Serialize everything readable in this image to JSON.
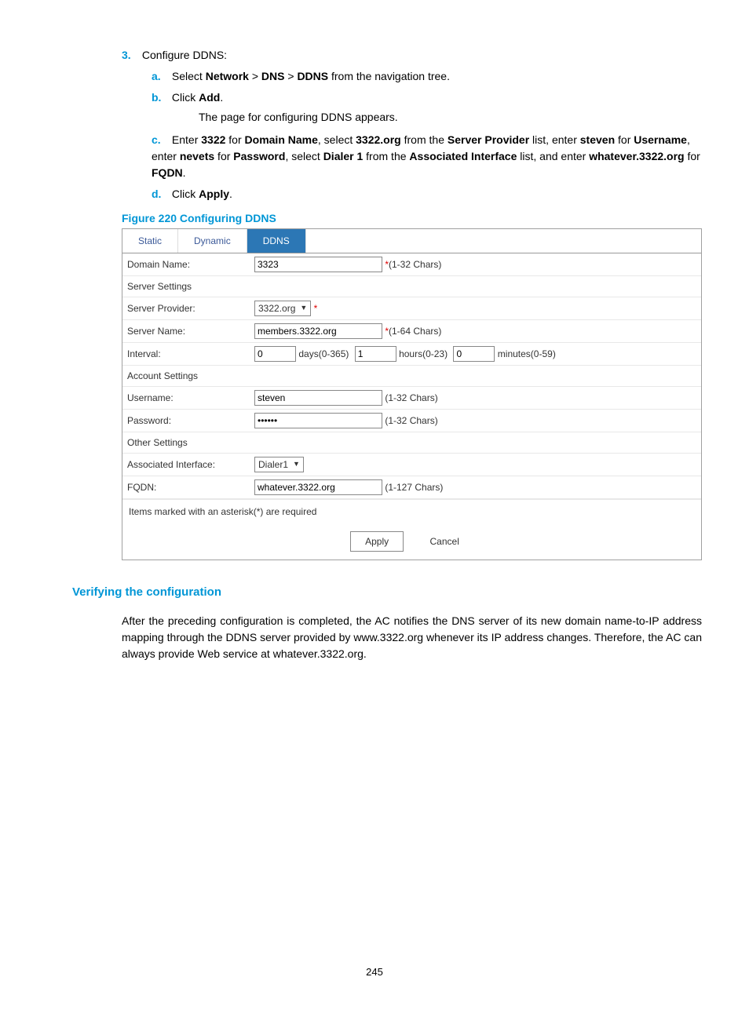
{
  "step": {
    "num": "3.",
    "title": "Configure DDNS:",
    "a": {
      "let": "a.",
      "pre": "Select ",
      "b1": "Network",
      "gt1": " > ",
      "b2": "DNS",
      "gt2": " > ",
      "b3": "DDNS",
      "post": " from the navigation tree."
    },
    "b": {
      "let": "b.",
      "pre": "Click ",
      "b1": "Add",
      "post": ".",
      "note": "The page for configuring DDNS appears."
    },
    "c": {
      "let": "c.",
      "t1": "Enter ",
      "b1": "3322",
      "t2": " for ",
      "b2": "Domain Name",
      "t3": ", select ",
      "b3": "3322.org",
      "t4": " from the ",
      "b4": "Server Provider",
      "t5": " list, enter ",
      "b5": "steven",
      "t6": " for ",
      "b6": "Username",
      "t7": ", enter ",
      "b7": "nevets",
      "t8": " for ",
      "b8": "Password",
      "t9": ", select ",
      "b9": "Dialer 1",
      "t10": " from the ",
      "b10": "Associated Interface",
      "t11": " list, and enter ",
      "b11": "whatever.3322.org",
      "t12": " for ",
      "b12": "FQDN",
      "t13": "."
    },
    "d": {
      "let": "d.",
      "pre": "Click ",
      "b1": "Apply",
      "post": "."
    }
  },
  "figure_caption": "Figure 220 Configuring DDNS",
  "shot": {
    "tabs": {
      "static": "Static",
      "dynamic": "Dynamic",
      "ddns": "DDNS"
    },
    "domain_label": "Domain Name:",
    "domain_value": "3323",
    "domain_hint": "*(1-32 Chars)",
    "server_settings": "Server Settings",
    "provider_label": "Server Provider:",
    "provider_value": "3322.org",
    "provider_star": "*",
    "servername_label": "Server Name:",
    "servername_value": "members.3322.org",
    "servername_hint": "*(1-64 Chars)",
    "interval_label": "Interval:",
    "days_value": "0",
    "days_label": "days(0-365)",
    "hours_value": "1",
    "hours_label": "hours(0-23)",
    "minutes_value": "0",
    "minutes_label": "minutes(0-59)",
    "account_settings": "Account Settings",
    "username_label": "Username:",
    "username_value": "steven",
    "username_hint": "(1-32 Chars)",
    "password_label": "Password:",
    "password_value": "••••••",
    "password_hint": "(1-32 Chars)",
    "other_settings": "Other Settings",
    "assoc_label": "Associated Interface:",
    "assoc_value": "Dialer1",
    "fqdn_label": "FQDN:",
    "fqdn_value": "whatever.3322.org",
    "fqdn_hint": "(1-127 Chars)",
    "required_note": "Items marked with an asterisk(*) are required",
    "apply": "Apply",
    "cancel": "Cancel"
  },
  "verify": {
    "heading": "Verifying the configuration",
    "para": "After the preceding configuration is completed, the AC notifies the DNS server of its new domain name-to-IP address mapping through the DDNS server provided by www.3322.org whenever its IP address changes. Therefore, the AC can always provide Web service at whatever.3322.org."
  },
  "page_number": "245"
}
